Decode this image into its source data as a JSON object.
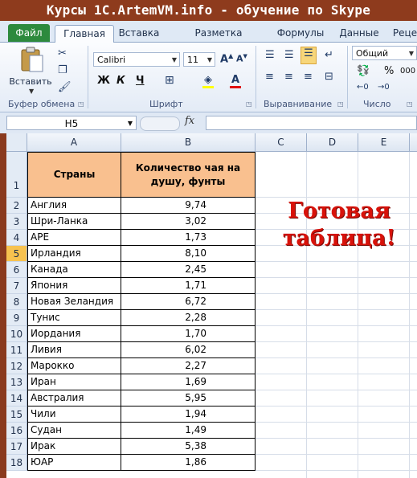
{
  "banner": "Курсы 1C.ArtemVM.info - обучение по Skype",
  "tabs": {
    "file": "Файл",
    "items": [
      "Главная",
      "Вставка",
      "Разметка страницы",
      "Формулы",
      "Данные",
      "Реце"
    ]
  },
  "ribbon": {
    "paste_label": "Вставить",
    "font_name": "Calibri",
    "font_size": "11",
    "number_format": "Общий",
    "bold": "Ж",
    "italic": "К",
    "underline": "Ч",
    "percent": "%",
    "thousands": "000",
    "groups": {
      "clipboard": "Буфер обмена",
      "font": "Шрифт",
      "alignment": "Выравнивание",
      "number": "Число"
    }
  },
  "formula_bar": {
    "name_box": "H5",
    "fx": "fx",
    "value": ""
  },
  "columns": [
    "A",
    "B",
    "C",
    "D",
    "E"
  ],
  "header": {
    "row_num": "1",
    "col_a": "Страны",
    "col_b": "Количество чая на душу, фунты"
  },
  "rows": [
    {
      "n": "2",
      "country": "Англия",
      "value": "9,74"
    },
    {
      "n": "3",
      "country": "Шри-Ланка",
      "value": "3,02"
    },
    {
      "n": "4",
      "country": "АРЕ",
      "value": "1,73"
    },
    {
      "n": "5",
      "country": "Ирландия",
      "value": "8,10"
    },
    {
      "n": "6",
      "country": "Канада",
      "value": "2,45"
    },
    {
      "n": "7",
      "country": "Япония",
      "value": "1,71"
    },
    {
      "n": "8",
      "country": "Новая Зеландия",
      "value": "6,72"
    },
    {
      "n": "9",
      "country": "Тунис",
      "value": "2,28"
    },
    {
      "n": "10",
      "country": "Иордания",
      "value": "1,70"
    },
    {
      "n": "11",
      "country": "Ливия",
      "value": "6,02"
    },
    {
      "n": "12",
      "country": "Марокко",
      "value": "2,27"
    },
    {
      "n": "13",
      "country": "Иран",
      "value": "1,69"
    },
    {
      "n": "14",
      "country": "Австралия",
      "value": "5,95"
    },
    {
      "n": "15",
      "country": "Чили",
      "value": "1,94"
    },
    {
      "n": "16",
      "country": "Судан",
      "value": "1,49"
    },
    {
      "n": "17",
      "country": "Ирак",
      "value": "5,38"
    },
    {
      "n": "18",
      "country": "ЮАР",
      "value": "1,86"
    }
  ],
  "selected_row": "5",
  "annotation": {
    "line1": "Готовая",
    "line2": "таблица!"
  },
  "colors": {
    "banner": "#8e3b1d",
    "header_fill": "#f9c08f",
    "file_tab": "#2d8a3d",
    "annotation": "#d8120a"
  }
}
